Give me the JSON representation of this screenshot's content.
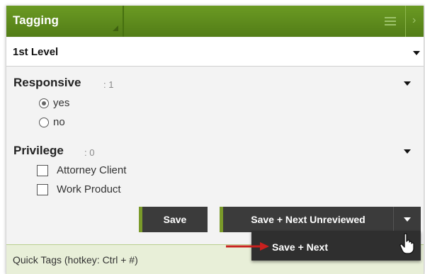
{
  "panel": {
    "title": "Tagging",
    "level_select": "1st Level"
  },
  "responsive": {
    "title": "Responsive",
    "count": ": 1",
    "options": [
      {
        "label": "yes",
        "checked": true
      },
      {
        "label": "no",
        "checked": false
      }
    ]
  },
  "privilege": {
    "title": "Privilege",
    "count": ": 0",
    "options": [
      {
        "label": "Attorney Client",
        "checked": false
      },
      {
        "label": "Work Product",
        "checked": false
      }
    ]
  },
  "buttons": {
    "save": "Save",
    "save_next_unreviewed": "Save + Next Unreviewed"
  },
  "dropdown": {
    "item": "Save + Next"
  },
  "quick_tags": {
    "label": "Quick Tags (hotkey: Ctrl + #)"
  },
  "icons": [
    "menu-icon",
    "chevron-right-icon",
    "caret-down-icon",
    "arrow-right-icon",
    "hand-pointer-icon"
  ],
  "colors": {
    "header_green": "#5f8a1f",
    "button_dark": "#3b3b3b",
    "accent_green": "#7a9a2a",
    "footer_tint": "#e8efd8",
    "annotation_red": "#c8201e"
  }
}
